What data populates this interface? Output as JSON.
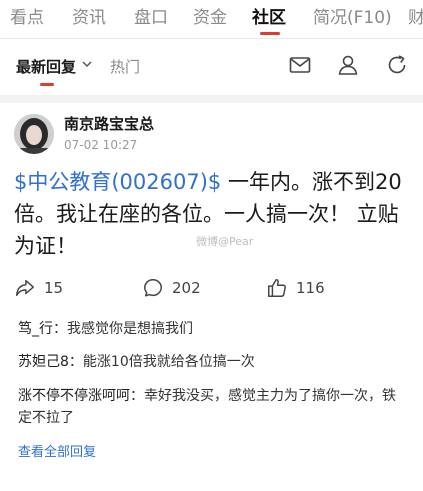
{
  "top_tabs": [
    "看点",
    "资讯",
    "盘口",
    "资金",
    "社区",
    "简况(F10)",
    "财"
  ],
  "active_tab": "社区",
  "subnav": {
    "sort_label": "最新回复",
    "hot_label": "热门"
  },
  "post": {
    "author": "南京路宝宝总",
    "time": "07-02 10:27",
    "stock": "$中公教育(002607)$",
    "text_after_stock": " 一年内。涨不到20倍。我让在座的各位。一人搞一次！ 立贴为证！",
    "watermark": "微博@Pear",
    "shares": "15",
    "comments": "202",
    "likes": "116"
  },
  "replies": [
    {
      "name": "笃_行",
      "text": "我感觉你是想搞我们"
    },
    {
      "name": "苏妲己8",
      "text": "能涨10倍我就给各位搞一次"
    },
    {
      "name": "涨不停不停涨呵呵",
      "text": "幸好我没买，感觉主力为了搞你一次，铁定不拉了"
    }
  ],
  "view_all_label": "查看全部回复",
  "colors": {
    "accent_red": "#e03b2f",
    "link_blue": "#2f6fd6"
  },
  "icons": [
    "mail-icon",
    "profile-icon",
    "refresh-icon",
    "share-icon",
    "comment-icon",
    "like-icon",
    "chevron-down-icon"
  ]
}
